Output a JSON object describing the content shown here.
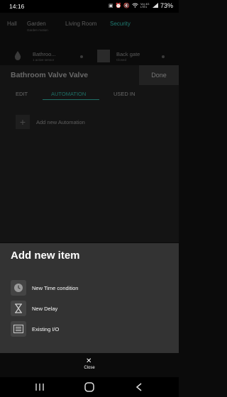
{
  "status_bar": {
    "time": "14:16",
    "net": "Vo) 4G LTE1",
    "battery": "73%"
  },
  "location_tabs": [
    {
      "label": "Hall",
      "sub": ""
    },
    {
      "label": "Garden",
      "sub": "Garden motion"
    },
    {
      "label": "Living Room",
      "sub": ""
    },
    {
      "label": "Security",
      "sub": ""
    }
  ],
  "devices": [
    {
      "name": "Bathroo...",
      "sub": "1 active sensor"
    },
    {
      "name": "Back gate",
      "sub": "Closed"
    }
  ],
  "page": {
    "title": "Bathroom Valve Valve",
    "done_label": "Done",
    "tabs": [
      "EDIT",
      "AUTOMATION",
      "USED IN"
    ],
    "active_tab": "AUTOMATION",
    "add_automation_label": "Add new Automation"
  },
  "sheet": {
    "title": "Add new item",
    "items": [
      {
        "label": "New Time condition",
        "icon": "clock-icon"
      },
      {
        "label": "New Delay",
        "icon": "hourglass-icon"
      },
      {
        "label": "Existing I/O",
        "icon": "list-icon"
      }
    ],
    "close_label": "Close"
  },
  "colors": {
    "accent": "#1f7a70",
    "sheet_bg": "#333333"
  }
}
